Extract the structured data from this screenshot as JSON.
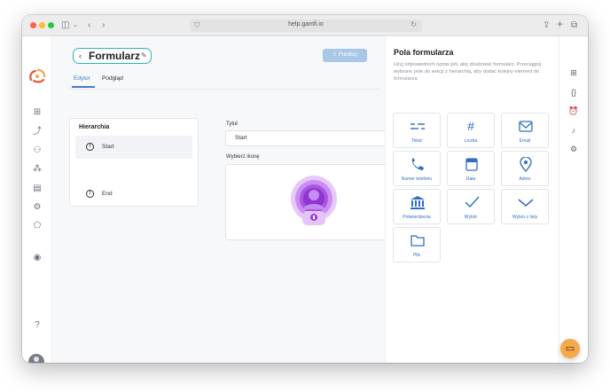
{
  "browser": {
    "url": "help.gamfi.io"
  },
  "header": {
    "title": "Formularz",
    "publish_label": "Publikuj"
  },
  "tabs": [
    {
      "label": "Edytor",
      "active": true
    },
    {
      "label": "Podgląd",
      "active": false
    }
  ],
  "hierarchy": {
    "title": "Hierarchia",
    "items": [
      {
        "label": "Start",
        "selected": true
      },
      {
        "label": "End",
        "selected": false
      }
    ]
  },
  "editor": {
    "title_label": "Tytuł",
    "title_value": "Start",
    "icon_label": "Wybierz ikonę"
  },
  "panel": {
    "title": "Pola formularza",
    "description": "Użyj odpowiednich typów pól, aby zbudować formularz. Przeciągnij wybrane pole do sekcji z hierarchią, aby dodać kolejny element do formularza.",
    "fields": [
      {
        "label": "Tekst",
        "icon": "text-lines-icon"
      },
      {
        "label": "Liczba",
        "icon": "hash-icon"
      },
      {
        "label": "Email",
        "icon": "envelope-icon"
      },
      {
        "label": "Numer telefonu",
        "icon": "phone-icon"
      },
      {
        "label": "Data",
        "icon": "calendar-icon"
      },
      {
        "label": "Adres",
        "icon": "location-pin-icon"
      },
      {
        "label": "Potwierdzenia",
        "icon": "bank-icon"
      },
      {
        "label": "Wybór",
        "icon": "checkmark-icon"
      },
      {
        "label": "Wybór z listy",
        "icon": "chevron-down-icon"
      },
      {
        "label": "Plik",
        "icon": "folder-icon"
      }
    ]
  },
  "colors": {
    "accent": "#2f6fc0",
    "pill_border": "#2fb5b0",
    "publish_disabled": "#a9c7e6",
    "icon_purple": "#9b3fd8",
    "fab": "#f5a94a"
  }
}
